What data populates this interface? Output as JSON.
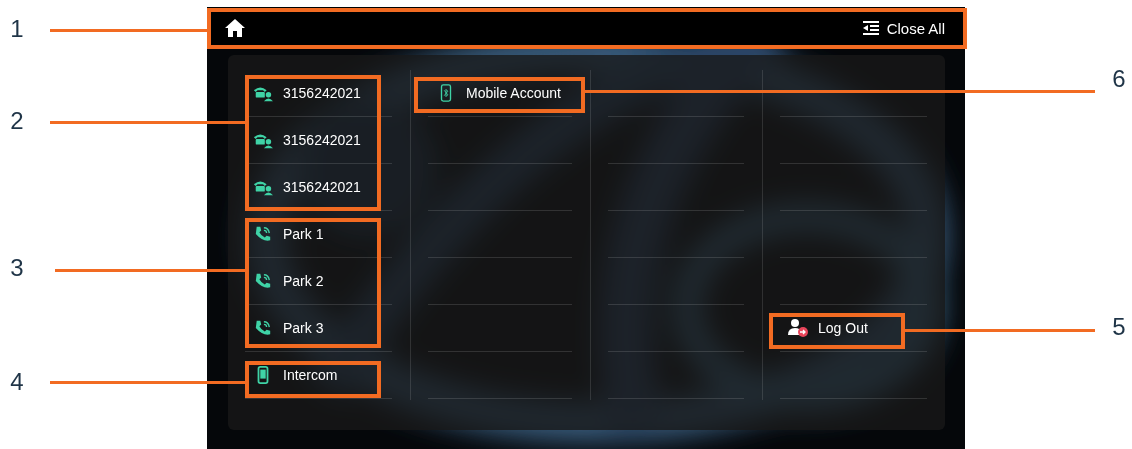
{
  "header": {
    "close_all": "Close All"
  },
  "columns": [
    {
      "keys": [
        {
          "kind": "line",
          "label": "3156242021"
        },
        {
          "kind": "line",
          "label": "3156242021"
        },
        {
          "kind": "line",
          "label": "3156242021"
        },
        {
          "kind": "park",
          "label": "Park 1"
        },
        {
          "kind": "park",
          "label": "Park 2"
        },
        {
          "kind": "park",
          "label": "Park 3"
        },
        {
          "kind": "intercom",
          "label": "Intercom"
        }
      ]
    },
    {
      "keys": [
        {
          "kind": "mobile",
          "label": "Mobile Account"
        },
        {
          "kind": "empty"
        },
        {
          "kind": "empty"
        },
        {
          "kind": "empty"
        },
        {
          "kind": "empty"
        },
        {
          "kind": "empty"
        },
        {
          "kind": "empty"
        }
      ]
    },
    {
      "keys": [
        {
          "kind": "empty"
        },
        {
          "kind": "empty"
        },
        {
          "kind": "empty"
        },
        {
          "kind": "empty"
        },
        {
          "kind": "empty"
        },
        {
          "kind": "empty"
        },
        {
          "kind": "empty"
        }
      ]
    },
    {
      "keys": [
        {
          "kind": "empty"
        },
        {
          "kind": "empty"
        },
        {
          "kind": "empty"
        },
        {
          "kind": "empty"
        },
        {
          "kind": "empty"
        },
        {
          "kind": "logout",
          "label": "Log Out"
        },
        {
          "kind": "empty"
        }
      ]
    }
  ],
  "callouts": [
    {
      "number": "1"
    },
    {
      "number": "2"
    },
    {
      "number": "3"
    },
    {
      "number": "4"
    },
    {
      "number": "5"
    },
    {
      "number": "6"
    }
  ]
}
